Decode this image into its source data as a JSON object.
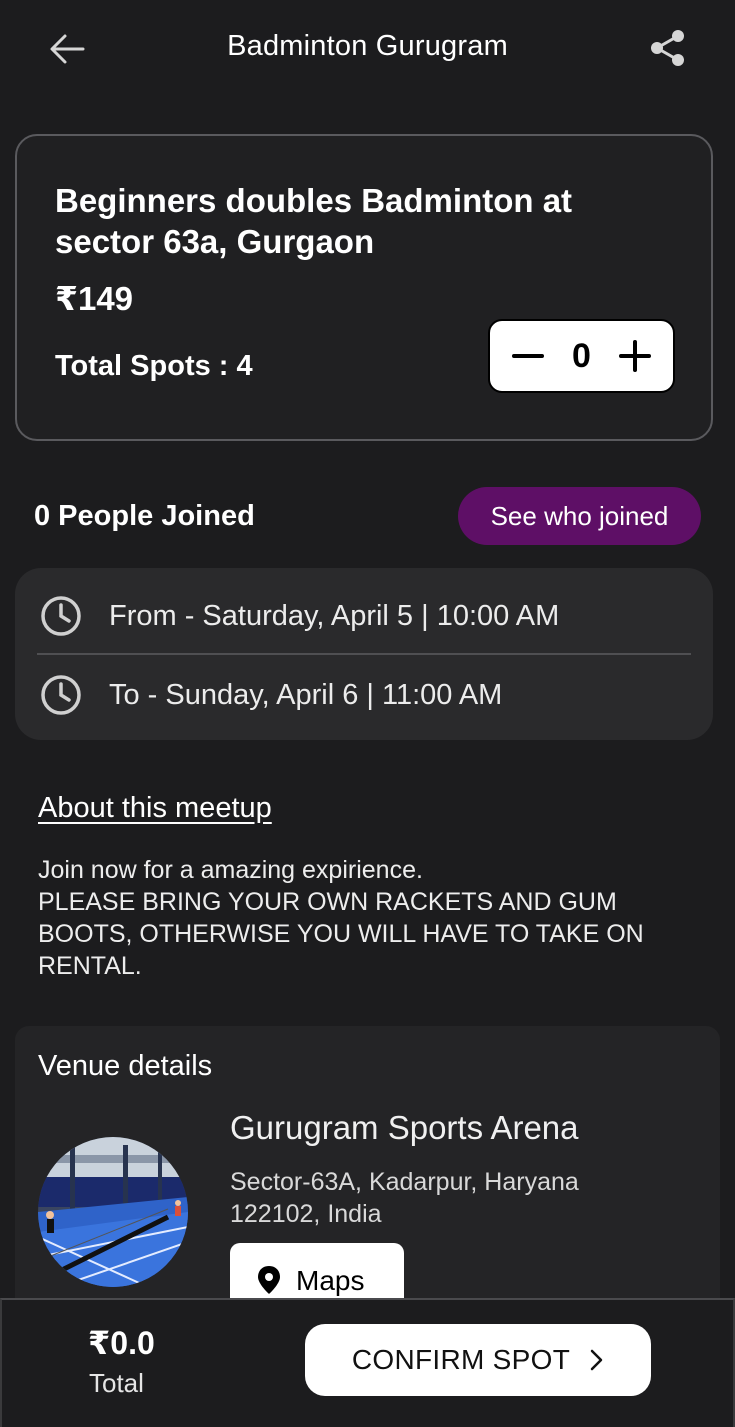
{
  "header": {
    "title": "Badminton Gurugram",
    "back_icon": "arrow-left-icon",
    "share_icon": "share-icon"
  },
  "event": {
    "title": "Beginners doubles Badminton at sector 63a, Gurgaon",
    "price": "₹149",
    "total_spots": "Total Spots : 4",
    "stepper": {
      "minus_icon": "minus-icon",
      "value": "0",
      "plus_icon": "plus-icon"
    }
  },
  "joined": {
    "text": "0 People Joined",
    "button_label": "See who joined",
    "button_color": "#5e0f66"
  },
  "schedule": {
    "from": "From - Saturday, April 5 | 10:00 AM",
    "to": "To - Sunday, April 6 | 11:00 AM",
    "icon": "clock-icon"
  },
  "about": {
    "heading": "About this meetup",
    "body": "Join now for a amazing expirience.\nPLEASE BRING YOUR OWN RACKETS AND GUM BOOTS, OTHERWISE YOU WILL HAVE TO TAKE ON RENTAL."
  },
  "venue": {
    "heading": "Venue details",
    "name": "Gurugram Sports Arena",
    "address": "Sector-63A, Kadarpur, Haryana 122102, India",
    "maps_label": "Maps",
    "maps_icon": "map-pin-icon"
  },
  "footer": {
    "total_amount": "₹0.0",
    "total_label": "Total",
    "confirm_label": "CONFIRM SPOT",
    "confirm_icon": "chevron-right-icon"
  }
}
